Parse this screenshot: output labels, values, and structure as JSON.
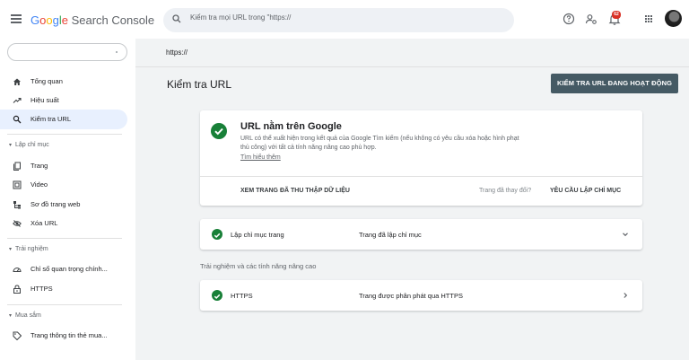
{
  "header": {
    "app_name_parts": [
      "G",
      "o",
      "o",
      "g",
      "l",
      "e"
    ],
    "app_name_rest": " Search Console",
    "search_placeholder": "Kiểm tra mọi URL trong \"https://",
    "notification_count": "62",
    "icons": [
      "menu-icon",
      "search-icon",
      "help-icon",
      "user-settings-icon",
      "bell-icon",
      "apps-grid-icon",
      "avatar"
    ]
  },
  "sidebar": {
    "items": [
      {
        "label": "Tổng quan",
        "icon": "home-icon"
      },
      {
        "label": "Hiệu suất",
        "icon": "trending-up-icon"
      },
      {
        "label": "Kiểm tra URL",
        "icon": "search-icon"
      }
    ],
    "sections": [
      {
        "title": "Lập chỉ mục",
        "items": [
          {
            "label": "Trang",
            "icon": "pages-icon"
          },
          {
            "label": "Video",
            "icon": "video-icon"
          },
          {
            "label": "Sơ đồ trang web",
            "icon": "sitemap-icon"
          },
          {
            "label": "Xóa URL",
            "icon": "eye-off-icon"
          }
        ]
      },
      {
        "title": "Trải nghiệm",
        "items": [
          {
            "label": "Chỉ số quan trọng chính...",
            "icon": "gauge-icon"
          },
          {
            "label": "HTTPS",
            "icon": "lock-icon"
          }
        ]
      },
      {
        "title": "Mua sắm",
        "items": [
          {
            "label": "Trang thông tin thẻ mua...",
            "icon": "tag-icon"
          }
        ]
      }
    ]
  },
  "main": {
    "inspected_url": "https://",
    "page_title": "Kiểm tra URL",
    "live_test_label": "KIỂM TRA URL ĐANG HOẠT ĐỘNG",
    "result": {
      "title": "URL nằm trên Google",
      "description": "URL có thể xuất hiện trong kết quả của Google Tìm kiếm (nếu không có yêu cầu xóa hoặc hình phạt thủ công) với tất cả tính năng nâng cao phù hợp.",
      "learn_more": "Tìm hiểu thêm",
      "view_crawled": "XEM TRANG ĐÃ THU THẬP DỮ LIỆU",
      "page_changed": "Trang đã thay đổi?",
      "request_indexing": "YÊU CẦU LẬP CHỈ MỤC"
    },
    "indexing_row": {
      "name": "Lập chỉ mục trang",
      "status": "Trang đã lập chỉ mục"
    },
    "enhancements_header": "Trải nghiệm và các tính năng nâng cao",
    "https_row": {
      "name": "HTTPS",
      "status": "Trang được phân phát qua HTTPS"
    }
  }
}
